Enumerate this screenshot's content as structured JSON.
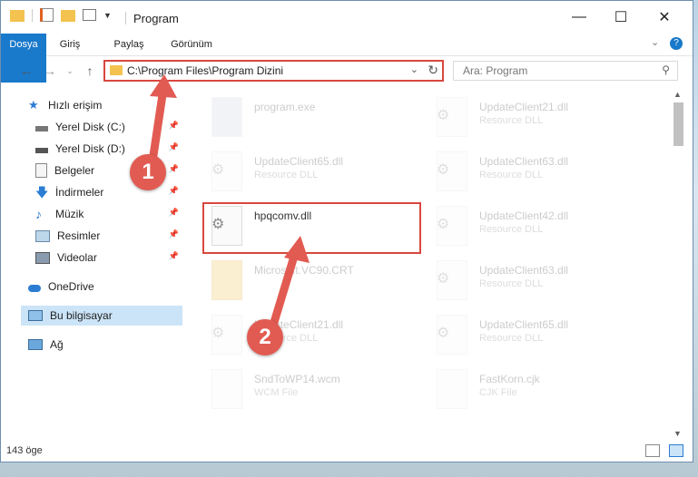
{
  "window": {
    "title": "Program"
  },
  "ribbon": {
    "tabs": [
      "Dosya",
      "Giriş",
      "Paylaş",
      "Görünüm"
    ]
  },
  "address": {
    "path": "C:\\Program Files\\Program Dizini"
  },
  "search": {
    "placeholder": "Ara: Program"
  },
  "sidebar": {
    "items": [
      {
        "label": "Hızlı erişim",
        "icon": "star-icon"
      },
      {
        "label": "Yerel Disk (C:)",
        "icon": "drive-icon"
      },
      {
        "label": "Yerel Disk (D:)",
        "icon": "drive-icon"
      },
      {
        "label": "Belgeler",
        "icon": "documents-icon"
      },
      {
        "label": "İndirmeler",
        "icon": "download-icon"
      },
      {
        "label": "Müzik",
        "icon": "music-icon"
      },
      {
        "label": "Resimler",
        "icon": "pictures-icon"
      },
      {
        "label": "Videolar",
        "icon": "videos-icon"
      },
      {
        "label": "OneDrive",
        "icon": "cloud-icon"
      },
      {
        "label": "Bu bilgisayar",
        "icon": "computer-icon"
      },
      {
        "label": "Ağ",
        "icon": "network-icon"
      }
    ]
  },
  "files": [
    {
      "name": "program.exe",
      "type": ""
    },
    {
      "name": "UpdateClient21.dll",
      "type": "Resource DLL"
    },
    {
      "name": "UpdateClient65.dll",
      "type": "Resource DLL"
    },
    {
      "name": "UpdateClient63.dll",
      "type": "Resource DLL"
    },
    {
      "name": "hpqcomv.dll",
      "type": ""
    },
    {
      "name": "UpdateClient42.dll",
      "type": "Resource DLL"
    },
    {
      "name": "Microsoft.VC90.CRT",
      "type": ""
    },
    {
      "name": "UpdateClient63.dll",
      "type": "Resource DLL"
    },
    {
      "name": "UpdateClient21.dll",
      "type": "Resource DLL"
    },
    {
      "name": "UpdateClient65.dll",
      "type": "Resource DLL"
    },
    {
      "name": "SndToWP14.wcm",
      "type": "WCM File"
    },
    {
      "name": "FastKorn.cjk",
      "type": "CJK File"
    }
  ],
  "status": {
    "count": "143 öge"
  },
  "annotations": {
    "step1": "1",
    "step2": "2",
    "color": "#e25b52"
  }
}
